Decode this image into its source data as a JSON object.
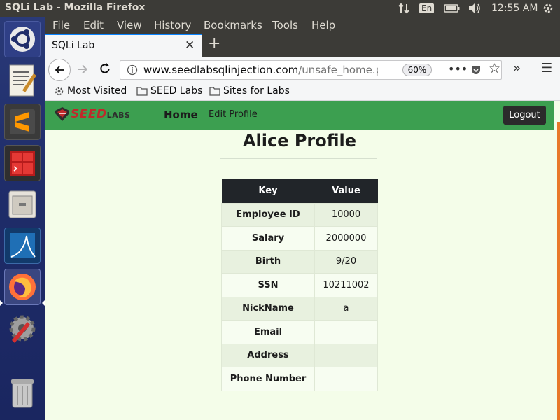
{
  "top_panel": {
    "window_title": "SQLi Lab - Mozilla Firefox",
    "keyboard_lang": "En",
    "clock": "12:55 AM"
  },
  "launcher": {
    "items": [
      {
        "name": "ubuntu-dash",
        "color": "#e95420"
      },
      {
        "name": "text-editor",
        "color": "#f0eee8"
      },
      {
        "name": "sublime-text",
        "color": "#ff9800"
      },
      {
        "name": "terminal",
        "color": "#b71c1c"
      },
      {
        "name": "file-manager",
        "color": "#e6e2da"
      },
      {
        "name": "wireshark",
        "color": "#1f6fb5"
      },
      {
        "name": "firefox",
        "color": "#ff7139"
      },
      {
        "name": "system-settings",
        "color": "#9e9e9e"
      },
      {
        "name": "trash",
        "color": "#b0b0b0"
      }
    ]
  },
  "menubar": {
    "items": [
      "File",
      "Edit",
      "View",
      "History",
      "Bookmarks",
      "Tools",
      "Help"
    ]
  },
  "tab": {
    "title": "SQLi Lab"
  },
  "urlbar": {
    "host": "www.seedlabsqlinjection.com",
    "path": "/unsafe_home.php",
    "zoom": "60%"
  },
  "bookmarks": {
    "items": [
      "Most Visited",
      "SEED Labs",
      "Sites for Labs"
    ]
  },
  "site": {
    "logo_text": "SEED",
    "logo_sub": "LABS",
    "nav_home": "Home",
    "nav_edit": "Edit Profile",
    "logout": "Logout",
    "profile_title": "Alice Profile",
    "table": {
      "headers": [
        "Key",
        "Value"
      ],
      "rows": [
        {
          "key": "Employee ID",
          "value": "10000"
        },
        {
          "key": "Salary",
          "value": "2000000"
        },
        {
          "key": "Birth",
          "value": "9/20"
        },
        {
          "key": "SSN",
          "value": "10211002"
        },
        {
          "key": "NickName",
          "value": "a"
        },
        {
          "key": "Email",
          "value": ""
        },
        {
          "key": "Address",
          "value": ""
        },
        {
          "key": "Phone Number",
          "value": ""
        }
      ]
    }
  },
  "colors": {
    "site_nav_green": "#3c9f50",
    "page_bg": "#f4fde9",
    "table_header": "#212529",
    "accent_tab": "#0a84ff"
  }
}
